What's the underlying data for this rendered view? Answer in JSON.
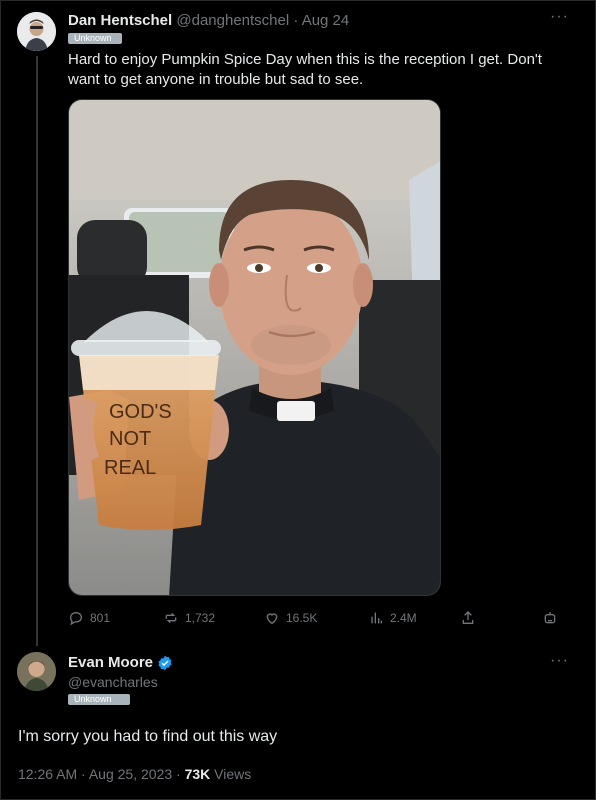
{
  "tweet": {
    "author_name": "Dan Hentschel",
    "author_handle": "@danghentschel",
    "separator": "·",
    "date": "Aug 24",
    "badge": "Unknown",
    "text": "Hard to enjoy Pumpkin Spice Day when this is the reception I get. Don't want to get anyone in trouble but sad to see.",
    "media": {
      "cup_text_lines": [
        "GOD'S",
        "NOT",
        "REAL"
      ]
    },
    "actions": {
      "replies": "801",
      "retweets": "1,732",
      "likes": "16.5K",
      "views": "2.4M"
    }
  },
  "reply": {
    "author_name": "Evan Moore",
    "author_handle": "@evancharles",
    "badge": "Unknown",
    "text": "I'm sorry you had to find out this way",
    "time": "12:26 AM",
    "separator": "·",
    "date": "Aug 25, 2023",
    "view_count": "73K",
    "views_label": "Views"
  },
  "colors": {
    "background": "#000000",
    "text": "#e7e9ea",
    "muted": "#71767b",
    "verified": "#1d9bf0"
  }
}
